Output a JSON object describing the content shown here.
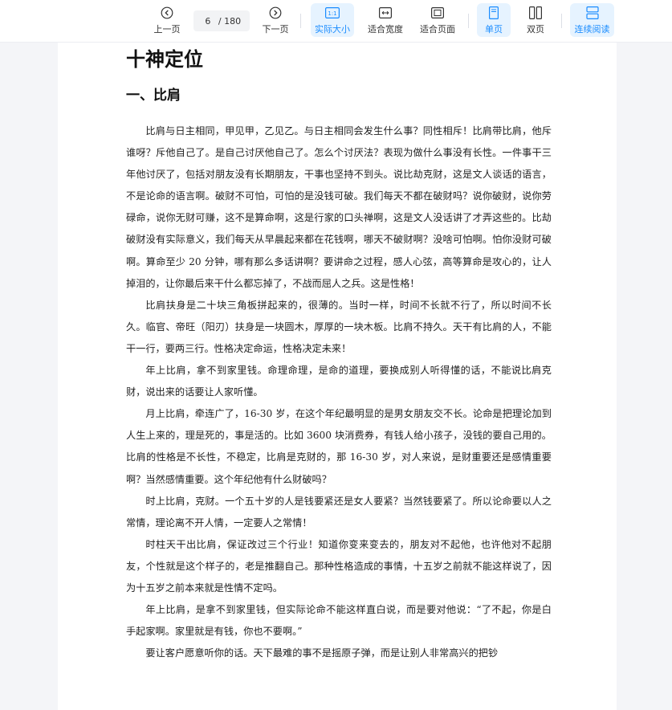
{
  "toolbar": {
    "prev_label": "上一页",
    "current_page": "6",
    "total_pages": "/ 180",
    "next_label": "下一页",
    "actual_size_label": "实际大小",
    "actual_size_icon_text": "1:1",
    "fit_width_label": "适合宽度",
    "fit_page_label": "适合页面",
    "single_page_label": "单页",
    "double_page_label": "双页",
    "continuous_label": "连续阅读",
    "accent_color": "#1a8cff",
    "active_bg": "#e6f3ff"
  },
  "document": {
    "title": "十神定位",
    "section_title": "一、比肩",
    "paragraphs": [
      "比肩与日主相同，甲见甲，乙见乙。与日主相同会发生什么事？同性相斥！比肩带比肩，他斥谁呀？斥他自己了。是自己讨厌他自己了。怎么个讨厌法？表现为做什么事没有长性。一件事干三年他讨厌了，包括对朋友没有长期朋友，干事也坚持不到头。说比劫克财，这是文人谈话的语言，不是论命的语言啊。破财不可怕，可怕的是没钱可破。我们每天不都在破财吗？说你破财，说你劳碌命，说你无财可赚，这不是算命啊，这是行家的口头禅啊，这是文人没话讲了才弄这些的。比劫破财没有实际意义，我们每天从早晨起来都在花钱啊，哪天不破财啊？没啥可怕啊。怕你没财可破啊。算命至少 20 分钟，哪有那么多话讲啊？要讲命之过程，感人心弦，高等算命是攻心的，让人掉泪的，让你最后来干什么都忘掉了，不战而屈人之兵。这是性格！",
      "比肩扶身是二十块三角板拼起来的，很薄的。当时一样，时间不长就不行了，所以时间不长久。临官、帝旺（阳刃）扶身是一块圆木，厚厚的一块木板。比肩不持久。天干有比肩的人，不能干一行，要两三行。性格决定命运，性格决定未来！",
      "年上比肩，拿不到家里钱。命理命理，是命的道理，要换成别人听得懂的话，不能说比肩克财，说出来的话要让人家听懂。",
      "月上比肩，牵连广了，16-30 岁，在这个年纪最明显的是男女朋友交不长。论命是把理论加到人生上来的，理是死的，事是活的。比如 3600 块消费券，有钱人给小孩子，没钱的要自己用的。比肩的性格是不长性，不稳定，比肩是克财的，那 16-30 岁，对人来说，是财重要还是感情重要啊？当然感情重要。这个年纪他有什么财破吗？",
      "时上比肩，克财。一个五十岁的人是钱要紧还是女人要紧？当然钱要紧了。所以论命要以人之常情，理论离不开人情，一定要人之常情！",
      "时柱天干出比肩，保证改过三个行业！知道你变来变去的，朋友对不起他，也许他对不起朋友，个性就是这个样子的，老是推翻自己。那种性格造成的事情，十五岁之前就不能这样说了，因为十五岁之前本来就是性情不定吗。",
      "年上比肩，是拿不到家里钱，但实际论命不能这样直白说，而是要对他说：“了不起，你是白手起家啊。家里就是有钱，你也不要啊。”",
      "要让客户愿意听你的话。天下最难的事不是摇原子弹，而是让别人非常高兴的把钞"
    ]
  }
}
